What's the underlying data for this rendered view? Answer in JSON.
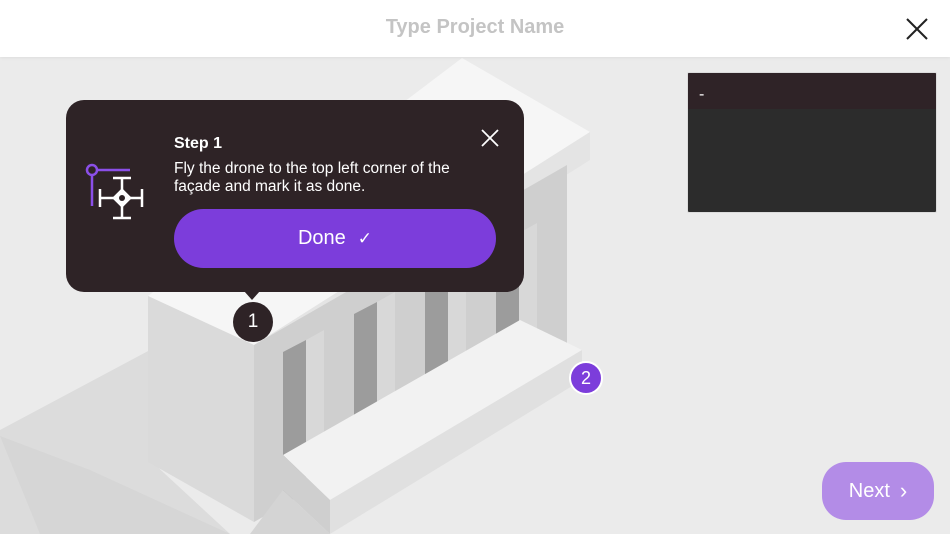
{
  "header": {
    "project_name_placeholder": "Type Project Name"
  },
  "preview_panel": {
    "label": "-"
  },
  "tooltip": {
    "title": "Step 1",
    "text": "Fly the drone to the top left corner of the façade and mark it as done.",
    "done_label": "Done",
    "done_icon": "✓"
  },
  "markers": {
    "marker_1": "1",
    "marker_2": "2"
  },
  "footer": {
    "next_label": "Next",
    "next_icon": "›"
  },
  "colors": {
    "accent": "#7c3ddb",
    "tooltip_bg": "#2e2326",
    "next_bg": "#b38ce7",
    "background": "#ebebeb"
  }
}
